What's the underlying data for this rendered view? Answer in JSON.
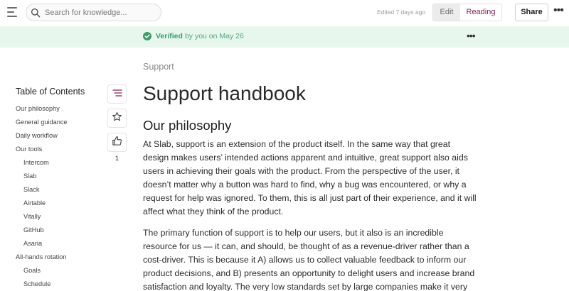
{
  "topbar": {
    "search_placeholder": "Search for knowledge...",
    "edited_text": "Edited 7 days ago",
    "edit_label": "Edit",
    "reading_label": "Reading",
    "share_label": "Share",
    "more_label": "•••"
  },
  "verified": {
    "word": "Verified",
    "rest": "by you on May 26",
    "more_label": "•••"
  },
  "toc": {
    "title": "Table of Contents",
    "items": [
      {
        "label": "Our philosophy",
        "level": 1
      },
      {
        "label": "General guidance",
        "level": 1
      },
      {
        "label": "Daily workflow",
        "level": 1
      },
      {
        "label": "Our tools",
        "level": 1
      },
      {
        "label": "Intercom",
        "level": 2
      },
      {
        "label": "Slab",
        "level": 2
      },
      {
        "label": "Slack",
        "level": 2
      },
      {
        "label": "Airtable",
        "level": 2
      },
      {
        "label": "Vitally",
        "level": 2
      },
      {
        "label": "GitHub",
        "level": 2
      },
      {
        "label": "Asana",
        "level": 2
      },
      {
        "label": "All-hands rotation",
        "level": 1
      },
      {
        "label": "Goals",
        "level": 2
      },
      {
        "label": "Schedule",
        "level": 2
      }
    ]
  },
  "actions": {
    "like_count": "1"
  },
  "doc": {
    "breadcrumb": "Support",
    "title": "Support handbook",
    "section_heading": "Our philosophy",
    "para1": "At Slab, support is an extension of the product itself. In the same way that great design makes users’ intended actions apparent and intuitive, great support also aids users in achieving their goals with the product. From the perspective of the user, it doesn’t matter why a button was hard to find, why a bug was encountered, or why a request for help was ignored. To them, this is all just part of their experience, and it will affect what they think of the product.",
    "para2": "The primary function of support is to help our users, but it also is an incredible resource for us — it can, and should, be thought of as a revenue-driver rather than a cost-driver. This is because it A) allows us to collect valuable feedback to inform our product decisions, and B) presents an opportunity to delight users and increase brand satisfaction and loyalty. The very low standards set by large companies make it very"
  },
  "colors": {
    "accent": "#8a1e5a",
    "verified_bg": "#e8f7ee",
    "verified_green": "#3c9c68"
  },
  "icons": [
    "menu-icon",
    "search-icon",
    "check-circle-icon",
    "toc-icon",
    "star-icon",
    "thumbs-up-icon"
  ]
}
